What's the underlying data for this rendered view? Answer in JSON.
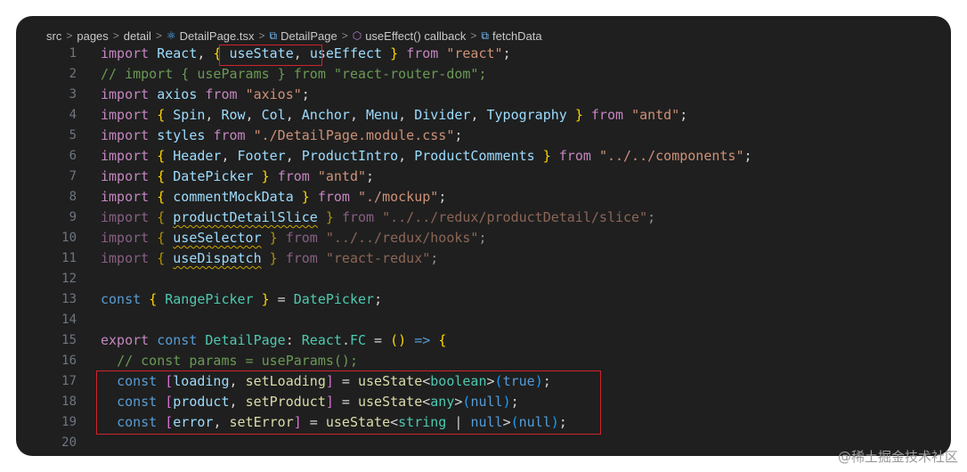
{
  "breadcrumb": {
    "items": [
      "src",
      "pages",
      "detail",
      "DetailPage.tsx",
      "DetailPage",
      "useEffect() callback",
      "fetchData"
    ],
    "separator": ">"
  },
  "code": {
    "line_numbers": [
      "1",
      "2",
      "3",
      "4",
      "5",
      "6",
      "7",
      "8",
      "9",
      "10",
      "11",
      "12",
      "13",
      "14",
      "15",
      "16",
      "17",
      "18",
      "19",
      "20"
    ],
    "lines": [
      [
        [
          "kw2",
          "import"
        ],
        [
          "op",
          " "
        ],
        [
          "var",
          "React"
        ],
        [
          "op",
          ", "
        ],
        [
          "brace",
          "{"
        ],
        [
          "op",
          " "
        ],
        [
          "var",
          "useState"
        ],
        [
          "op",
          ", "
        ],
        [
          "var",
          "useEffect"
        ],
        [
          "op",
          " "
        ],
        [
          "brace",
          "}"
        ],
        [
          "op",
          " "
        ],
        [
          "kw2",
          "from"
        ],
        [
          "op",
          " "
        ],
        [
          "str",
          "\"react\""
        ],
        [
          "op",
          ";"
        ]
      ],
      [
        [
          "cm",
          "// import { useParams } from \"react-router-dom\";"
        ]
      ],
      [
        [
          "kw2",
          "import"
        ],
        [
          "op",
          " "
        ],
        [
          "var",
          "axios"
        ],
        [
          "op",
          " "
        ],
        [
          "kw2",
          "from"
        ],
        [
          "op",
          " "
        ],
        [
          "str",
          "\"axios\""
        ],
        [
          "op",
          ";"
        ]
      ],
      [
        [
          "kw2",
          "import"
        ],
        [
          "op",
          " "
        ],
        [
          "brace",
          "{"
        ],
        [
          "op",
          " "
        ],
        [
          "var",
          "Spin"
        ],
        [
          "op",
          ", "
        ],
        [
          "var",
          "Row"
        ],
        [
          "op",
          ", "
        ],
        [
          "var",
          "Col"
        ],
        [
          "op",
          ", "
        ],
        [
          "var",
          "Anchor"
        ],
        [
          "op",
          ", "
        ],
        [
          "var",
          "Menu"
        ],
        [
          "op",
          ", "
        ],
        [
          "var",
          "Divider"
        ],
        [
          "op",
          ", "
        ],
        [
          "var",
          "Typography"
        ],
        [
          "op",
          " "
        ],
        [
          "brace",
          "}"
        ],
        [
          "op",
          " "
        ],
        [
          "kw2",
          "from"
        ],
        [
          "op",
          " "
        ],
        [
          "str",
          "\"antd\""
        ],
        [
          "op",
          ";"
        ]
      ],
      [
        [
          "kw2",
          "import"
        ],
        [
          "op",
          " "
        ],
        [
          "var",
          "styles"
        ],
        [
          "op",
          " "
        ],
        [
          "kw2",
          "from"
        ],
        [
          "op",
          " "
        ],
        [
          "str",
          "\"./DetailPage.module.css\""
        ],
        [
          "op",
          ";"
        ]
      ],
      [
        [
          "kw2",
          "import"
        ],
        [
          "op",
          " "
        ],
        [
          "brace",
          "{"
        ],
        [
          "op",
          " "
        ],
        [
          "var",
          "Header"
        ],
        [
          "op",
          ", "
        ],
        [
          "var",
          "Footer"
        ],
        [
          "op",
          ", "
        ],
        [
          "var",
          "ProductIntro"
        ],
        [
          "op",
          ", "
        ],
        [
          "var",
          "ProductComments"
        ],
        [
          "op",
          " "
        ],
        [
          "brace",
          "}"
        ],
        [
          "op",
          " "
        ],
        [
          "kw2",
          "from"
        ],
        [
          "op",
          " "
        ],
        [
          "str",
          "\"../../components\""
        ],
        [
          "op",
          ";"
        ]
      ],
      [
        [
          "kw2",
          "import"
        ],
        [
          "op",
          " "
        ],
        [
          "brace",
          "{"
        ],
        [
          "op",
          " "
        ],
        [
          "var",
          "DatePicker"
        ],
        [
          "op",
          " "
        ],
        [
          "brace",
          "}"
        ],
        [
          "op",
          " "
        ],
        [
          "kw2",
          "from"
        ],
        [
          "op",
          " "
        ],
        [
          "str",
          "\"antd\""
        ],
        [
          "op",
          ";"
        ]
      ],
      [
        [
          "kw2",
          "import"
        ],
        [
          "op",
          " "
        ],
        [
          "brace",
          "{"
        ],
        [
          "op",
          " "
        ],
        [
          "var",
          "commentMockData"
        ],
        [
          "op",
          " "
        ],
        [
          "brace",
          "}"
        ],
        [
          "op",
          " "
        ],
        [
          "kw2",
          "from"
        ],
        [
          "op",
          " "
        ],
        [
          "str",
          "\"./mockup\""
        ],
        [
          "op",
          ";"
        ]
      ],
      [
        [
          "kw2 dim",
          "import"
        ],
        [
          "op dim",
          " "
        ],
        [
          "brace dim",
          "{"
        ],
        [
          "op dim",
          " "
        ],
        [
          "var squig",
          "productDetailSlice"
        ],
        [
          "op dim",
          " "
        ],
        [
          "brace dim",
          "}"
        ],
        [
          "op dim",
          " "
        ],
        [
          "kw2 dim",
          "from"
        ],
        [
          "op dim",
          " "
        ],
        [
          "str dim",
          "\"../../redux/productDetail/slice\""
        ],
        [
          "op dim",
          ";"
        ]
      ],
      [
        [
          "kw2 dim",
          "import"
        ],
        [
          "op dim",
          " "
        ],
        [
          "brace dim",
          "{"
        ],
        [
          "op dim",
          " "
        ],
        [
          "var squig",
          "useSelector"
        ],
        [
          "op dim",
          " "
        ],
        [
          "brace dim",
          "}"
        ],
        [
          "op dim",
          " "
        ],
        [
          "kw2 dim",
          "from"
        ],
        [
          "op dim",
          " "
        ],
        [
          "str dim",
          "\"../../redux/hooks\""
        ],
        [
          "op dim",
          ";"
        ]
      ],
      [
        [
          "kw2 dim",
          "import"
        ],
        [
          "op dim",
          " "
        ],
        [
          "brace dim",
          "{"
        ],
        [
          "op dim",
          " "
        ],
        [
          "var squig",
          "useDispatch"
        ],
        [
          "op dim",
          " "
        ],
        [
          "brace dim",
          "}"
        ],
        [
          "op dim",
          " "
        ],
        [
          "kw2 dim",
          "from"
        ],
        [
          "op dim",
          " "
        ],
        [
          "str dim",
          "\"react-redux\""
        ],
        [
          "op dim",
          ";"
        ]
      ],
      [],
      [
        [
          "kw",
          "const"
        ],
        [
          "op",
          " "
        ],
        [
          "brace",
          "{"
        ],
        [
          "op",
          " "
        ],
        [
          "cls",
          "RangePicker"
        ],
        [
          "op",
          " "
        ],
        [
          "brace",
          "}"
        ],
        [
          "op",
          " = "
        ],
        [
          "cls",
          "DatePicker"
        ],
        [
          "op",
          ";"
        ]
      ],
      [],
      [
        [
          "kw2",
          "export"
        ],
        [
          "op",
          " "
        ],
        [
          "kw",
          "const"
        ],
        [
          "op",
          " "
        ],
        [
          "cls",
          "DetailPage"
        ],
        [
          "op",
          ": "
        ],
        [
          "cls",
          "React"
        ],
        [
          "op",
          "."
        ],
        [
          "cls",
          "FC"
        ],
        [
          "op",
          " = "
        ],
        [
          "brace",
          "()"
        ],
        [
          "op",
          " "
        ],
        [
          "kw",
          "=>"
        ],
        [
          "op",
          " "
        ],
        [
          "brace",
          "{"
        ]
      ],
      [
        [
          "op",
          "  "
        ],
        [
          "cm",
          "// const params = useParams();"
        ]
      ],
      [
        [
          "op",
          "  "
        ],
        [
          "kw",
          "const"
        ],
        [
          "op",
          " "
        ],
        [
          "brack",
          "["
        ],
        [
          "var",
          "loading"
        ],
        [
          "op",
          ", "
        ],
        [
          "fn",
          "setLoading"
        ],
        [
          "brack",
          "]"
        ],
        [
          "op",
          " = "
        ],
        [
          "fn",
          "useState"
        ],
        [
          "op",
          "<"
        ],
        [
          "type",
          "boolean"
        ],
        [
          "op",
          ">"
        ],
        [
          "par",
          "("
        ],
        [
          "kw",
          "true"
        ],
        [
          "par",
          ")"
        ],
        [
          "op",
          ";"
        ]
      ],
      [
        [
          "op",
          "  "
        ],
        [
          "kw",
          "const"
        ],
        [
          "op",
          " "
        ],
        [
          "brack",
          "["
        ],
        [
          "var",
          "product"
        ],
        [
          "op",
          ", "
        ],
        [
          "fn",
          "setProduct"
        ],
        [
          "brack",
          "]"
        ],
        [
          "op",
          " = "
        ],
        [
          "fn",
          "useState"
        ],
        [
          "op",
          "<"
        ],
        [
          "type",
          "any"
        ],
        [
          "op",
          ">"
        ],
        [
          "par",
          "("
        ],
        [
          "kw",
          "null"
        ],
        [
          "par",
          ")"
        ],
        [
          "op",
          ";"
        ]
      ],
      [
        [
          "op",
          "  "
        ],
        [
          "kw",
          "const"
        ],
        [
          "op",
          " "
        ],
        [
          "brack",
          "["
        ],
        [
          "var",
          "error"
        ],
        [
          "op",
          ", "
        ],
        [
          "fn",
          "setError"
        ],
        [
          "brack",
          "]"
        ],
        [
          "op",
          " = "
        ],
        [
          "fn",
          "useState"
        ],
        [
          "op",
          "<"
        ],
        [
          "type",
          "string"
        ],
        [
          "op",
          " | "
        ],
        [
          "kw",
          "null"
        ],
        [
          "op",
          ">"
        ],
        [
          "par",
          "("
        ],
        [
          "kw",
          "null"
        ],
        [
          "par",
          ")"
        ],
        [
          "op",
          ";"
        ]
      ],
      []
    ]
  },
  "watermark": "@稀土掘金技术社区",
  "colors": {
    "background": "#1f1f1f",
    "highlight_box": "#d0232b"
  }
}
